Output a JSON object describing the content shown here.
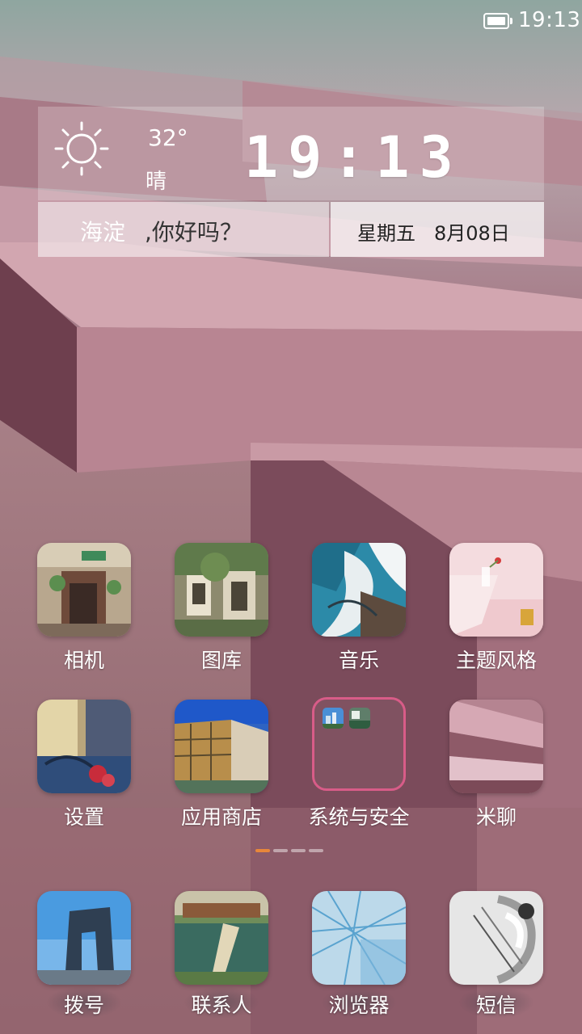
{
  "status_bar": {
    "time": "19:13",
    "battery_icon": "battery-icon"
  },
  "widget": {
    "temperature": "32°",
    "weather": "晴",
    "weather_icon": "sun-icon",
    "clock": "19:13",
    "city": "海淀",
    "greeting": ",你好吗？",
    "weekday": "星期五",
    "date": "8月08日"
  },
  "apps": [
    {
      "label": "相机",
      "icon": "camera-app-icon"
    },
    {
      "label": "图库",
      "icon": "gallery-app-icon"
    },
    {
      "label": "音乐",
      "icon": "music-app-icon"
    },
    {
      "label": "主题风格",
      "icon": "theme-app-icon"
    },
    {
      "label": "设置",
      "icon": "settings-app-icon"
    },
    {
      "label": "应用商店",
      "icon": "app-store-icon"
    },
    {
      "label": "系统与安全",
      "icon": "folder-icon"
    },
    {
      "label": "米聊",
      "icon": "miliao-app-icon"
    }
  ],
  "page_indicator": {
    "pages": 4,
    "current": 1,
    "active_color": "#e8873a"
  },
  "dock": [
    {
      "label": "拨号",
      "icon": "phone-app-icon"
    },
    {
      "label": "联系人",
      "icon": "contacts-app-icon"
    },
    {
      "label": "浏览器",
      "icon": "browser-app-icon"
    },
    {
      "label": "短信",
      "icon": "messages-app-icon"
    }
  ]
}
